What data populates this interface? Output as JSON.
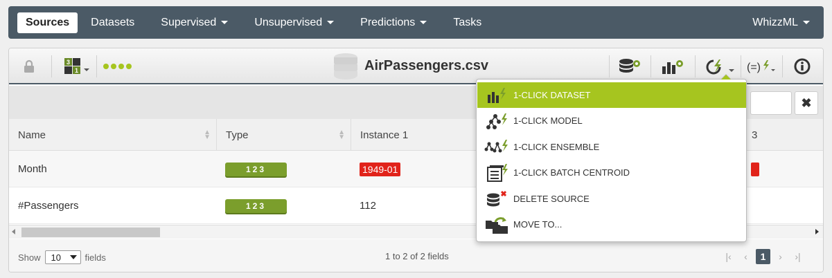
{
  "nav": {
    "items": [
      {
        "label": "Sources",
        "active": true,
        "has_caret": false
      },
      {
        "label": "Datasets",
        "active": false,
        "has_caret": false
      },
      {
        "label": "Supervised",
        "active": false,
        "has_caret": true
      },
      {
        "label": "Unsupervised",
        "active": false,
        "has_caret": true
      },
      {
        "label": "Predictions",
        "active": false,
        "has_caret": true
      },
      {
        "label": "Tasks",
        "active": false,
        "has_caret": false
      }
    ],
    "right_label": "WhizzML"
  },
  "toolbar": {
    "title": "AirPassengers.csv",
    "icons": [
      "lock-icon",
      "type-config-icon",
      "progress-dots-icon",
      "database-icon",
      "dataset-config-icon",
      "chart-config-icon",
      "one-click-icon",
      "formula-icon",
      "info-icon"
    ]
  },
  "table": {
    "columns": [
      "Name",
      "Type",
      "Instance 1",
      "3"
    ],
    "rows": [
      {
        "name": "Month",
        "type": "123",
        "instance1": "1949-01",
        "instance1_error": true
      },
      {
        "name": "#Passengers",
        "type": "123",
        "instance1": "112",
        "instance1_error": false
      }
    ]
  },
  "footer": {
    "show_label": "Show",
    "show_value": "10",
    "fields_label": "fields",
    "page_info": "1 to 2 of 2 fields",
    "current_page": "1"
  },
  "dropdown": {
    "items": [
      {
        "label": "1-CLICK DATASET",
        "icon": "dataset-bolt-icon",
        "active": true
      },
      {
        "label": "1-CLICK MODEL",
        "icon": "model-bolt-icon",
        "active": false
      },
      {
        "label": "1-CLICK ENSEMBLE",
        "icon": "ensemble-bolt-icon",
        "active": false
      },
      {
        "label": "1-CLICK BATCH CENTROID",
        "icon": "batch-centroid-bolt-icon",
        "active": false
      },
      {
        "label": "DELETE SOURCE",
        "icon": "delete-source-icon",
        "active": false
      },
      {
        "label": "MOVE TO...",
        "icon": "move-folder-icon",
        "active": false
      }
    ]
  },
  "colors": {
    "nav_bg": "#4b5a66",
    "accent_green": "#a6c51f",
    "type_badge": "#7b9e2c",
    "error_red": "#e1231a"
  }
}
